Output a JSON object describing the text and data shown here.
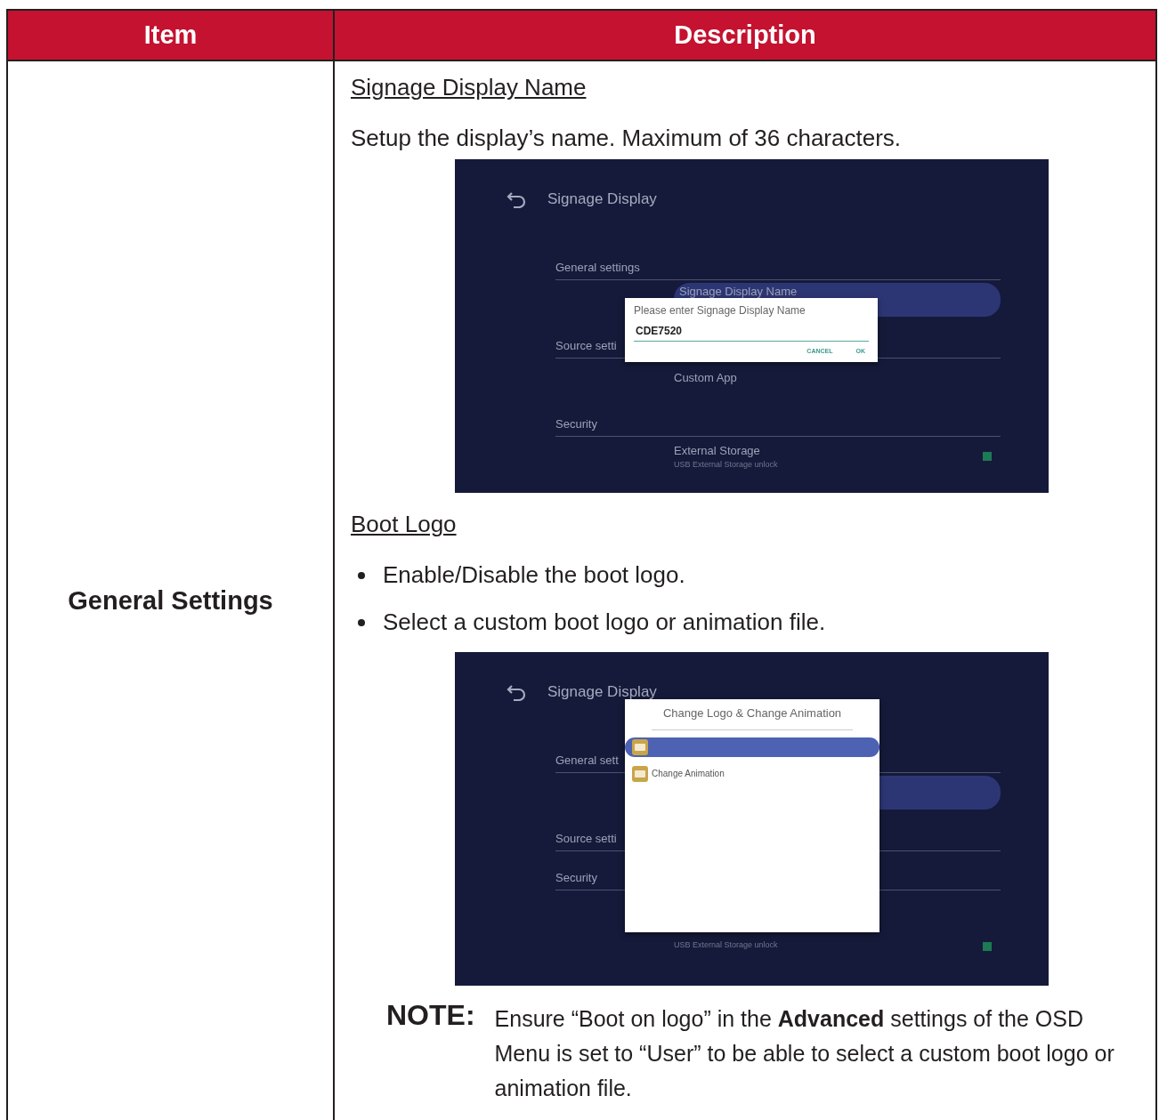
{
  "table": {
    "columns": [
      "Item",
      "Description"
    ],
    "rows": [
      {
        "item": "General Settings",
        "description": [
          {
            "kind": "heading",
            "text": "Signage Display Name"
          },
          {
            "kind": "paragraph",
            "text": "Setup the display’s name. Maximum of 36 characters."
          },
          {
            "kind": "screenshot",
            "screen": {
              "title": "Signage Display",
              "rows": [
                {
                  "kind": "section",
                  "text": "General settings"
                },
                {
                  "kind": "item",
                  "text": "Signage Display Name",
                  "selected": true
                },
                {
                  "kind": "section",
                  "text": "Source setti"
                },
                {
                  "kind": "item",
                  "text": "Custom App",
                  "selected": false
                },
                {
                  "kind": "section",
                  "text": "Security"
                },
                {
                  "kind": "item",
                  "text": "External Storage",
                  "subtext": "USB External Storage unlock",
                  "checked": true
                }
              ],
              "dialog": {
                "kind": "input",
                "title": "Please enter Signage Display Name",
                "value": "CDE7520",
                "buttons": [
                  "CANCEL",
                  "OK"
                ]
              }
            }
          },
          {
            "kind": "heading",
            "text": "Boot Logo"
          },
          {
            "kind": "bullets",
            "items": [
              "Enable/Disable the boot logo.",
              "Select a custom boot logo or animation file."
            ]
          },
          {
            "kind": "screenshot",
            "screen": {
              "title": "Signage Display",
              "rows": [
                {
                  "kind": "section",
                  "text": "General sett"
                },
                {
                  "kind": "item",
                  "selected": true
                },
                {
                  "kind": "section",
                  "text": "Source setti"
                },
                {
                  "kind": "section",
                  "text": "Security"
                },
                {
                  "kind": "item",
                  "subtext": "USB External Storage unlock",
                  "checked": true
                }
              ],
              "dialog": {
                "kind": "list",
                "title": "Change Logo & Change Animation",
                "items": [
                  {
                    "selected": true
                  },
                  {
                    "text": "Change Animation",
                    "selected": false
                  }
                ]
              }
            }
          },
          {
            "kind": "note",
            "label": "NOTE:",
            "text": "Ensure “Boot on logo” in the **Advanced** settings of the OSD Menu is set to “User” to be able to select a custom boot logo or animation file."
          }
        ]
      }
    ]
  }
}
